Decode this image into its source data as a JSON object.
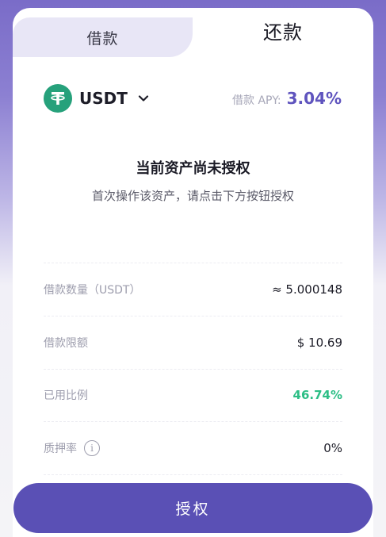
{
  "tabs": [
    {
      "label": "借款",
      "active": false
    },
    {
      "label": "还款",
      "active": true
    }
  ],
  "asset": {
    "name": "USDT",
    "icon": "tether-icon",
    "apy_label": "借款 APY:",
    "apy_value": "3.04%"
  },
  "authorization": {
    "title": "当前资产尚未授权",
    "subtitle": "首次操作该资产，请点击下方按钮授权"
  },
  "details": [
    {
      "label": "借款数量（USDT）",
      "value": "≈ 5.000148"
    },
    {
      "label": "借款限额",
      "value": "$ 10.69"
    },
    {
      "label": "已用比例",
      "value": "46.74%"
    },
    {
      "label": "质押率",
      "value": "0%"
    }
  ],
  "button": {
    "label": "授权"
  },
  "colors": {
    "accent": "#5A50B5",
    "tether": "#26A17B",
    "positive": "#2DBE86"
  }
}
